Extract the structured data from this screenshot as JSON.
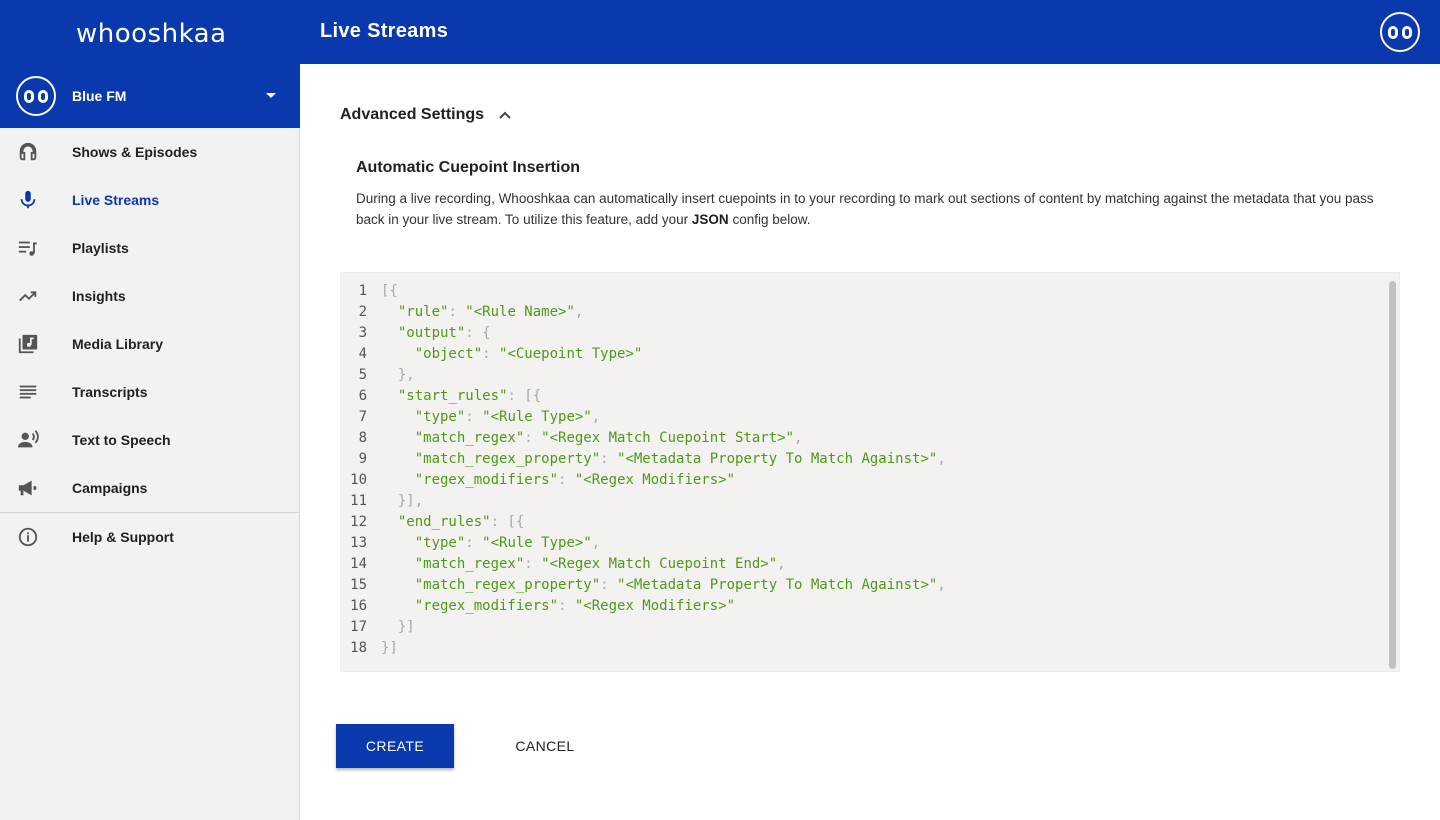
{
  "app": {
    "logo_text": "whooshkaa",
    "page_title": "Live Streams"
  },
  "station": {
    "name": "Blue FM"
  },
  "sidebar": {
    "items": [
      {
        "label": "Shows & Episodes",
        "icon": "headphones-icon"
      },
      {
        "label": "Live Streams",
        "icon": "microphone-icon",
        "active": true
      },
      {
        "label": "Playlists",
        "icon": "playlist-icon"
      },
      {
        "label": "Insights",
        "icon": "trending-up-icon"
      },
      {
        "label": "Media Library",
        "icon": "library-music-icon"
      },
      {
        "label": "Transcripts",
        "icon": "transcript-lines-icon"
      },
      {
        "label": "Text to Speech",
        "icon": "speaking-person-icon"
      },
      {
        "label": "Campaigns",
        "icon": "megaphone-icon"
      }
    ],
    "help": {
      "label": "Help & Support",
      "icon": "info-icon"
    }
  },
  "advanced": {
    "title": "Advanced Settings",
    "section_title": "Automatic Cuepoint Insertion",
    "description_before": "During a live recording, Whooshkaa can automatically insert cuepoints in to your recording to mark out sections of content by matching against the metadata that you pass back in your live stream. To utilize this feature, add your ",
    "description_bold": "JSON",
    "description_after": " config below."
  },
  "editor": {
    "lines": [
      "[{",
      "  \"rule\": \"<Rule Name>\",",
      "  \"output\": {",
      "    \"object\": \"<Cuepoint Type>\"",
      "  },",
      "  \"start_rules\": [{",
      "    \"type\": \"<Rule Type>\",",
      "    \"match_regex\": \"<Regex Match Cuepoint Start>\",",
      "    \"match_regex_property\": \"<Metadata Property To Match Against>\",",
      "    \"regex_modifiers\": \"<Regex Modifiers>\"",
      "  }],",
      "  \"end_rules\": [{",
      "    \"type\": \"<Rule Type>\",",
      "    \"match_regex\": \"<Regex Match Cuepoint End>\",",
      "    \"match_regex_property\": \"<Metadata Property To Match Against>\",",
      "    \"regex_modifiers\": \"<Regex Modifiers>\"",
      "  }]",
      "}]"
    ]
  },
  "actions": {
    "create_label": "CREATE",
    "cancel_label": "CANCEL"
  },
  "colors": {
    "brand_blue": "#0a38ad",
    "sidebar_bg": "#f2f2f2",
    "editor_bg": "#f4f2f1",
    "json_string": "#4c9a16",
    "json_punct": "#a8a8a8"
  }
}
